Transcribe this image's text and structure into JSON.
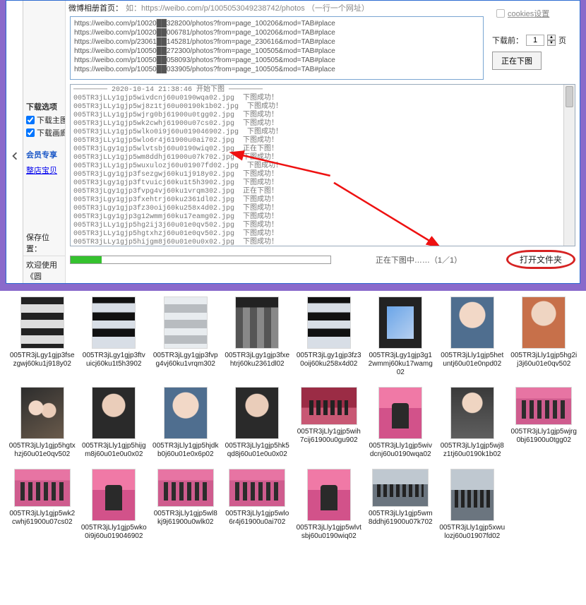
{
  "header": {
    "label_prefix": "微博相册首页：",
    "hint": "如：https://weibo.com/p/1005053049238742/photos （一行一个网址）"
  },
  "urls": [
    "https://weibo.com/p/10020██328200/photos?from=page_100206&mod=TAB#place",
    "https://weibo.com/p/10020██006781/photos?from=page_100206&mod=TAB#place",
    "https://weibo.com/p/23061██145281/photos?from=page_230616&mod=TAB#place",
    "https://weibo.com/p/10050██272300/photos?from=page_100505&mod=TAB#place",
    "https://weibo.com/p/10050██058093/photos?from=page_100505&mod=TAB#place",
    "https://weibo.com/p/10050██033905/photos?from=page_100505&mod=TAB#place"
  ],
  "cookies_label": "cookies设置",
  "download_before": {
    "label_left": "下载前：",
    "value": "1",
    "label_right": "页"
  },
  "start_button": "正在下图",
  "sidebar": {
    "section_download_options": "下载选项",
    "chk1": "下载主图",
    "chk2": "下载画廊",
    "section_member": "会员专享",
    "link_store": "整店宝贝",
    "save_label": "保存位置：",
    "welcome": "欢迎使用《圆"
  },
  "log_header": " 2020-10-14 21:38:46 开始下图 ",
  "log_lines": [
    "005TR3jLLy1gjp5wivdcnj60u0190wqa02.jpg  下图成功！",
    "005TR3jLLy1gjp5wj8z1tj60u00190k1b02.jpg  下图成功！",
    "005TR3jLLy1gjp5wjrg0bj61900u0tgg02.jpg  下图成功！",
    "005TR3jLLy1gjp5wk2cwhj61900u07cs02.jpg  下图成功！",
    "005TR3jLLy1gjp5wlko0i9j60u019046902.jpg  下图成功！",
    "005TR3jLLy1gjp5wlo6r4j61900u0ai702.jpg  下图成功！",
    "005TR3jLgy1gjp5wlvtsbj60u0190wiq02.jpg  正在下图！",
    "005TR3jLLy1gjp5wm8ddhj61900u07k702.jpg  下图成功！",
    "005TR3jLLy1gjp5wuxulozj60u01907fd02.jpg  下图成功！",
    "005TR3jLgy1gjp3fsezgwj60ku1j918y02.jpg  下图成功！",
    "005TR3jLgy1gjp3ftvuicj60ku1t5h3902.jpg  下图成功！",
    "005TR3jLgy1gjp3fvpg4vj60ku1vrqm302.jpg  正在下图！",
    "005TR3jLgy1gjp3fxehtrj60ku2361dl02.jpg  下图成功！",
    "005TR3jLgy1gjp3fz30oij60ku258x4d02.jpg  下图成功！",
    "005TR3jLgy1gjp3g12wmmj60ku17eamg02.jpg  下图成功！",
    "005TR3jLLy1gjp5hg2ij3j60u01e0qv502.jpg  下图成功！",
    "005TR3jLLy1gjp5hgtxhzj60u01e0qv502.jpg  下图成功！",
    "005TR3jLLy1gjp5hijgm8j60u01e0u0x02.jpg  下图成功！"
  ],
  "progress": {
    "percent": 12
  },
  "status_text": "正在下图中……（1／1）",
  "open_folder": "打开文件夹",
  "files": [
    {
      "name": "005TR3jLgy1gjp3fsezgwj60ku1j918y02",
      "cls": "t-strip"
    },
    {
      "name": "005TR3jLgy1gjp3ftvuicj60ku1t5h3902",
      "cls": "t-strip-wide"
    },
    {
      "name": "005TR3jLgy1gjp3fvpg4vj60ku1vrqm302",
      "cls": "t-strip-light"
    },
    {
      "name": "005TR3jLgy1gjp3fxehtrj60ku2361dl02",
      "cls": "t-mosaic"
    },
    {
      "name": "005TR3jLgy1gjp3fz30oij60ku258x4d02",
      "cls": "t-strip-wide"
    },
    {
      "name": "005TR3jLgy1gjp3g12wmmj60ku17wamg02",
      "cls": "t-card"
    },
    {
      "name": "005TR3jLly1gjp5hetuntj60u01e0npd02",
      "cls": "t-portrait1"
    },
    {
      "name": "005TR3jLly1gjp5hg2ij3j60u01e0qv502",
      "cls": "t-portrait2"
    },
    {
      "name": "005TR3jLly1gjp5hgtxhzj60u01e0qv502",
      "cls": "t-couple"
    },
    {
      "name": "005TR3jLly1gjp5hijgm8j60u01e0u0x02",
      "cls": "t-portrait3"
    },
    {
      "name": "005TR3jLly1gjp5hjdkb0j60u01e0x6p02",
      "cls": "t-portrait1"
    },
    {
      "name": "005TR3jLly1gjp5hk5qd8j60u01e0u0x02",
      "cls": "t-portrait3"
    },
    {
      "name": "005TR3jLly1gjp5wih7cij61900u0gu902",
      "cls": "t-stage-red",
      "wide": true
    },
    {
      "name": "005TR3jLly1gjp5wivdcnj60u0190wqa02",
      "cls": "t-stage-pink"
    },
    {
      "name": "005TR3jLly1gjp5wj8z1tj60u0190k1b02",
      "cls": "t-woman"
    },
    {
      "name": "005TR3jLly1gjp5wjrg0bj61900u0tgg02",
      "cls": "t-pinkcast",
      "wide": true
    },
    {
      "name": "005TR3jLly1gjp5wk2cwhj61900u07cs02",
      "cls": "t-pinkcast",
      "wide": true
    },
    {
      "name": "005TR3jLly1gjp5wko0i9j60u019046902",
      "cls": "t-stage-pink"
    },
    {
      "name": "005TR3jLly1gjp5wl8kj9j61900u0wlk02",
      "cls": "t-pinkcast",
      "wide": true
    },
    {
      "name": "005TR3jLly1gjp5wlo6r4j61900u0ai702",
      "cls": "t-pinkcast",
      "wide": true
    },
    {
      "name": "005TR3jLly1gjp5wlvtsbj60u0190wiq02",
      "cls": "t-stage-pink"
    },
    {
      "name": "005TR3jLly1gjp5wm8ddhj61900u07k702",
      "cls": "t-group",
      "wide": true
    },
    {
      "name": "005TR3jLly1gjp5xwulozj60u01907fd02",
      "cls": "t-group"
    },
    {
      "name": "",
      "cls": "t-empty",
      "empty": true
    }
  ]
}
